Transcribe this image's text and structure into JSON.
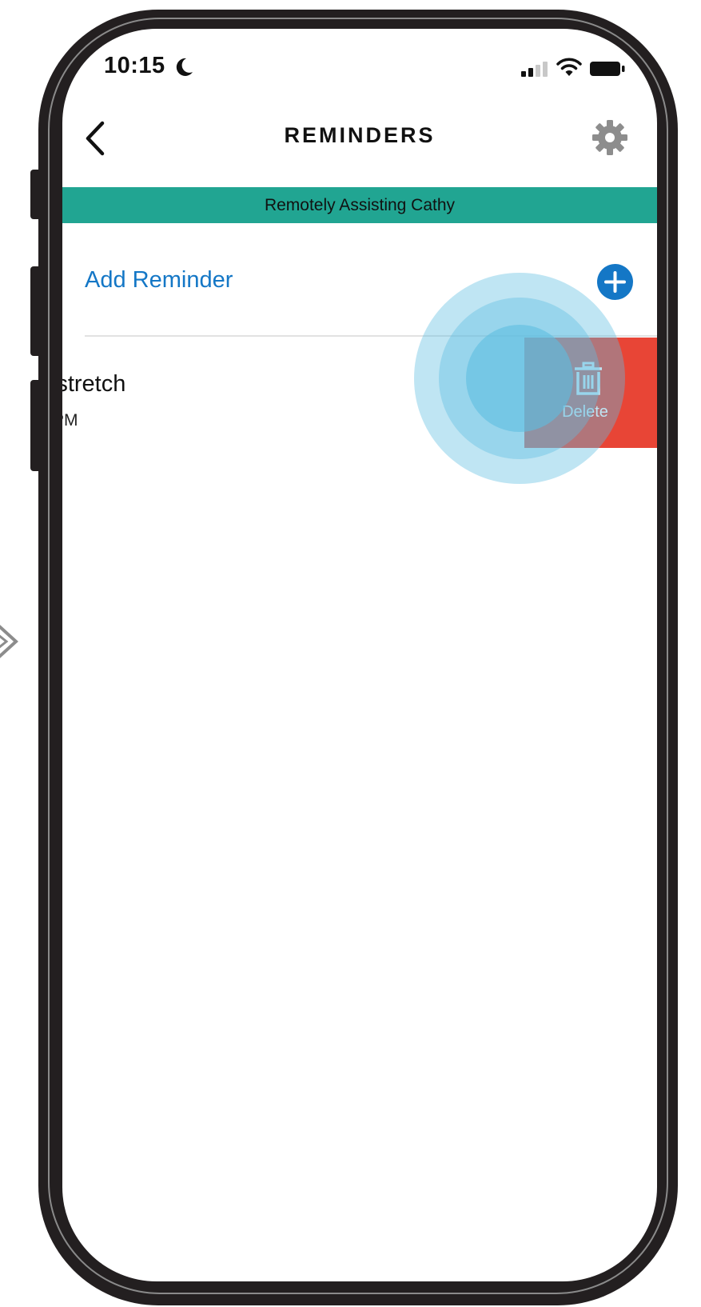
{
  "status_bar": {
    "time": "10:15",
    "moon_icon": "moon-icon",
    "signal_icon": "cellular-signal-icon",
    "wifi_icon": "wifi-icon",
    "battery_icon": "battery-icon"
  },
  "nav": {
    "title": "REMINDERS",
    "back_icon": "chevron-left-icon",
    "settings_icon": "gear-icon"
  },
  "banner": {
    "text": "Remotely Assisting Cathy",
    "color": "#21a592"
  },
  "add_reminder": {
    "label": "Add Reminder",
    "icon": "plus-circle-icon",
    "color": "#1477c6"
  },
  "reminders": [
    {
      "title": "nd stretch",
      "time": "PM",
      "delete_label": "Delete",
      "delete_icon": "trash-icon",
      "delete_color": "#e84536"
    }
  ]
}
